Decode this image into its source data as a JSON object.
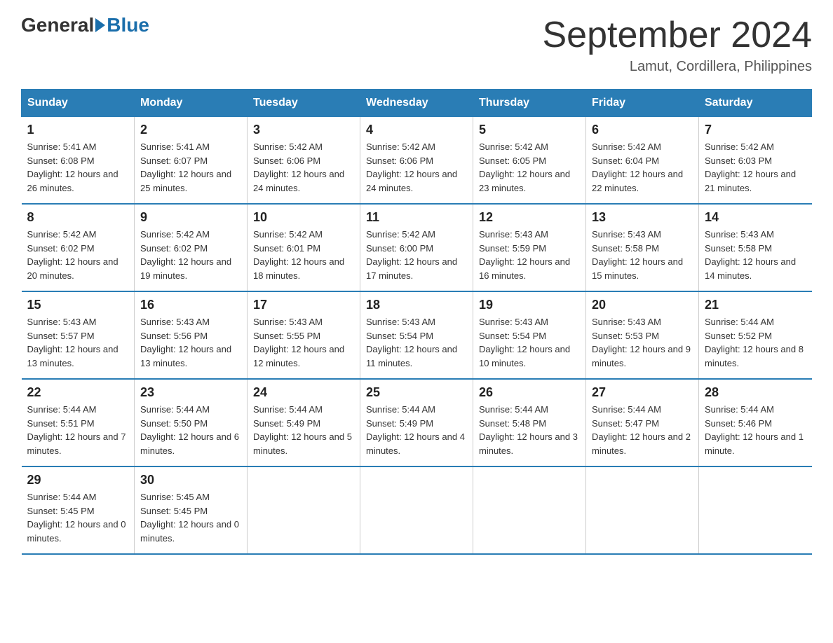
{
  "logo": {
    "general": "General",
    "blue": "Blue"
  },
  "title": "September 2024",
  "location": "Lamut, Cordillera, Philippines",
  "headers": [
    "Sunday",
    "Monday",
    "Tuesday",
    "Wednesday",
    "Thursday",
    "Friday",
    "Saturday"
  ],
  "weeks": [
    [
      {
        "day": "1",
        "sunrise": "Sunrise: 5:41 AM",
        "sunset": "Sunset: 6:08 PM",
        "daylight": "Daylight: 12 hours and 26 minutes."
      },
      {
        "day": "2",
        "sunrise": "Sunrise: 5:41 AM",
        "sunset": "Sunset: 6:07 PM",
        "daylight": "Daylight: 12 hours and 25 minutes."
      },
      {
        "day": "3",
        "sunrise": "Sunrise: 5:42 AM",
        "sunset": "Sunset: 6:06 PM",
        "daylight": "Daylight: 12 hours and 24 minutes."
      },
      {
        "day": "4",
        "sunrise": "Sunrise: 5:42 AM",
        "sunset": "Sunset: 6:06 PM",
        "daylight": "Daylight: 12 hours and 24 minutes."
      },
      {
        "day": "5",
        "sunrise": "Sunrise: 5:42 AM",
        "sunset": "Sunset: 6:05 PM",
        "daylight": "Daylight: 12 hours and 23 minutes."
      },
      {
        "day": "6",
        "sunrise": "Sunrise: 5:42 AM",
        "sunset": "Sunset: 6:04 PM",
        "daylight": "Daylight: 12 hours and 22 minutes."
      },
      {
        "day": "7",
        "sunrise": "Sunrise: 5:42 AM",
        "sunset": "Sunset: 6:03 PM",
        "daylight": "Daylight: 12 hours and 21 minutes."
      }
    ],
    [
      {
        "day": "8",
        "sunrise": "Sunrise: 5:42 AM",
        "sunset": "Sunset: 6:02 PM",
        "daylight": "Daylight: 12 hours and 20 minutes."
      },
      {
        "day": "9",
        "sunrise": "Sunrise: 5:42 AM",
        "sunset": "Sunset: 6:02 PM",
        "daylight": "Daylight: 12 hours and 19 minutes."
      },
      {
        "day": "10",
        "sunrise": "Sunrise: 5:42 AM",
        "sunset": "Sunset: 6:01 PM",
        "daylight": "Daylight: 12 hours and 18 minutes."
      },
      {
        "day": "11",
        "sunrise": "Sunrise: 5:42 AM",
        "sunset": "Sunset: 6:00 PM",
        "daylight": "Daylight: 12 hours and 17 minutes."
      },
      {
        "day": "12",
        "sunrise": "Sunrise: 5:43 AM",
        "sunset": "Sunset: 5:59 PM",
        "daylight": "Daylight: 12 hours and 16 minutes."
      },
      {
        "day": "13",
        "sunrise": "Sunrise: 5:43 AM",
        "sunset": "Sunset: 5:58 PM",
        "daylight": "Daylight: 12 hours and 15 minutes."
      },
      {
        "day": "14",
        "sunrise": "Sunrise: 5:43 AM",
        "sunset": "Sunset: 5:58 PM",
        "daylight": "Daylight: 12 hours and 14 minutes."
      }
    ],
    [
      {
        "day": "15",
        "sunrise": "Sunrise: 5:43 AM",
        "sunset": "Sunset: 5:57 PM",
        "daylight": "Daylight: 12 hours and 13 minutes."
      },
      {
        "day": "16",
        "sunrise": "Sunrise: 5:43 AM",
        "sunset": "Sunset: 5:56 PM",
        "daylight": "Daylight: 12 hours and 13 minutes."
      },
      {
        "day": "17",
        "sunrise": "Sunrise: 5:43 AM",
        "sunset": "Sunset: 5:55 PM",
        "daylight": "Daylight: 12 hours and 12 minutes."
      },
      {
        "day": "18",
        "sunrise": "Sunrise: 5:43 AM",
        "sunset": "Sunset: 5:54 PM",
        "daylight": "Daylight: 12 hours and 11 minutes."
      },
      {
        "day": "19",
        "sunrise": "Sunrise: 5:43 AM",
        "sunset": "Sunset: 5:54 PM",
        "daylight": "Daylight: 12 hours and 10 minutes."
      },
      {
        "day": "20",
        "sunrise": "Sunrise: 5:43 AM",
        "sunset": "Sunset: 5:53 PM",
        "daylight": "Daylight: 12 hours and 9 minutes."
      },
      {
        "day": "21",
        "sunrise": "Sunrise: 5:44 AM",
        "sunset": "Sunset: 5:52 PM",
        "daylight": "Daylight: 12 hours and 8 minutes."
      }
    ],
    [
      {
        "day": "22",
        "sunrise": "Sunrise: 5:44 AM",
        "sunset": "Sunset: 5:51 PM",
        "daylight": "Daylight: 12 hours and 7 minutes."
      },
      {
        "day": "23",
        "sunrise": "Sunrise: 5:44 AM",
        "sunset": "Sunset: 5:50 PM",
        "daylight": "Daylight: 12 hours and 6 minutes."
      },
      {
        "day": "24",
        "sunrise": "Sunrise: 5:44 AM",
        "sunset": "Sunset: 5:49 PM",
        "daylight": "Daylight: 12 hours and 5 minutes."
      },
      {
        "day": "25",
        "sunrise": "Sunrise: 5:44 AM",
        "sunset": "Sunset: 5:49 PM",
        "daylight": "Daylight: 12 hours and 4 minutes."
      },
      {
        "day": "26",
        "sunrise": "Sunrise: 5:44 AM",
        "sunset": "Sunset: 5:48 PM",
        "daylight": "Daylight: 12 hours and 3 minutes."
      },
      {
        "day": "27",
        "sunrise": "Sunrise: 5:44 AM",
        "sunset": "Sunset: 5:47 PM",
        "daylight": "Daylight: 12 hours and 2 minutes."
      },
      {
        "day": "28",
        "sunrise": "Sunrise: 5:44 AM",
        "sunset": "Sunset: 5:46 PM",
        "daylight": "Daylight: 12 hours and 1 minute."
      }
    ],
    [
      {
        "day": "29",
        "sunrise": "Sunrise: 5:44 AM",
        "sunset": "Sunset: 5:45 PM",
        "daylight": "Daylight: 12 hours and 0 minutes."
      },
      {
        "day": "30",
        "sunrise": "Sunrise: 5:45 AM",
        "sunset": "Sunset: 5:45 PM",
        "daylight": "Daylight: 12 hours and 0 minutes."
      },
      null,
      null,
      null,
      null,
      null
    ]
  ]
}
